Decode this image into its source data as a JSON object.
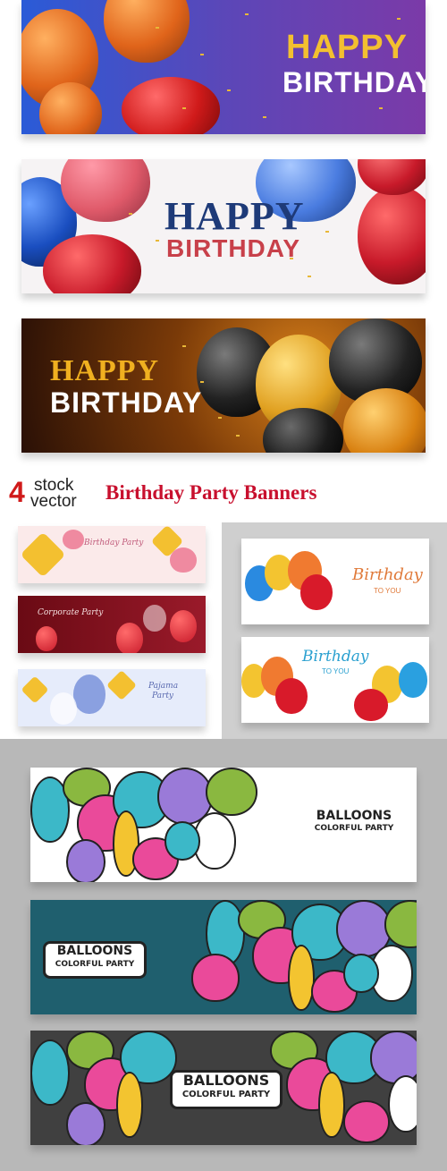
{
  "banner1": {
    "happy": "HAPPY",
    "birthday": "BIRTHDAY"
  },
  "banner2": {
    "happy": "HAPPY",
    "birthday": "BIRTHDAY"
  },
  "banner3": {
    "happy": "HAPPY",
    "birthday": "BIRTHDAY"
  },
  "brand": {
    "number": "4",
    "stock": "stock",
    "vector": "vector"
  },
  "heading": "Birthday Party Banners",
  "thumbs": {
    "birthday_party": "Birthday Party",
    "corporate_party": "Corporate Party",
    "pajama_party_1": "Pajama",
    "pajama_party_2": "Party",
    "birthday_to_you_1": {
      "title": "Birthday",
      "sub": "TO YOU"
    },
    "birthday_to_you_2": {
      "title": "Birthday",
      "sub": "TO YOU"
    }
  },
  "cartoon": {
    "line1": "BALLOONS",
    "line2": "COLORFUL PARTY"
  },
  "colors": {
    "heading_red": "#c8102e",
    "brand_red": "#d01a1a",
    "purple_bg": "#6a3c9c",
    "teal_bg": "#1f5f6e",
    "dark_bg": "#404040"
  }
}
